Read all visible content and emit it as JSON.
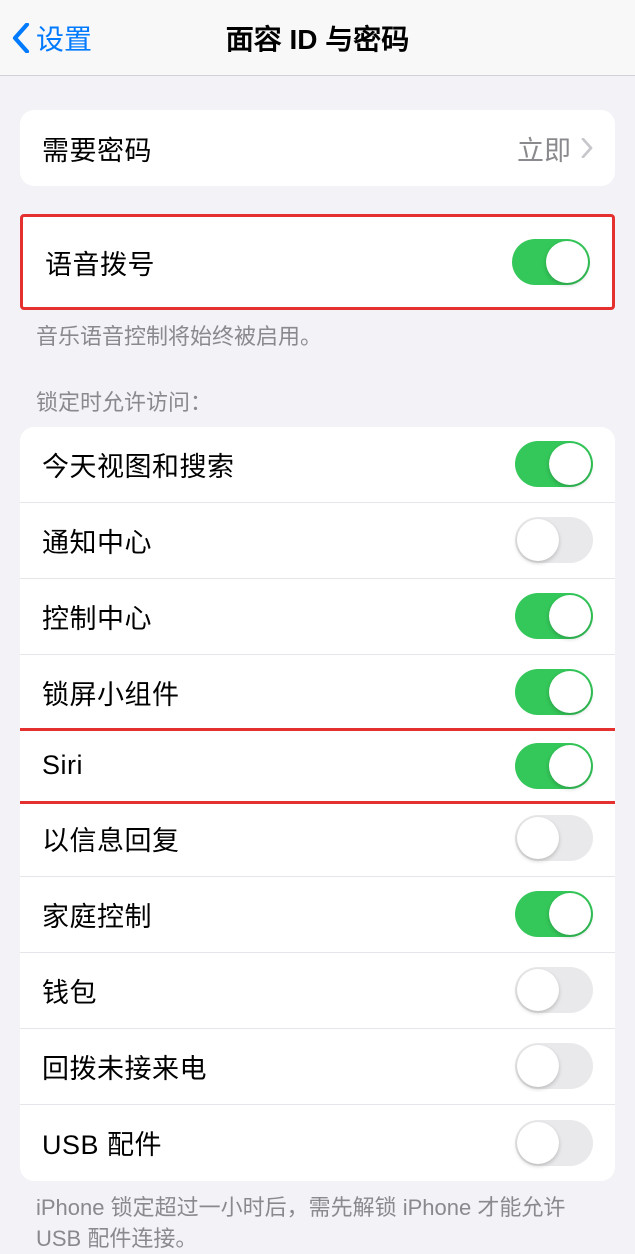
{
  "nav": {
    "back_label": "设置",
    "title": "面容 ID 与密码"
  },
  "passcode_section": {
    "require_passcode_label": "需要密码",
    "require_passcode_value": "立即"
  },
  "voice_dial_section": {
    "label": "语音拨号",
    "enabled": true,
    "footer": "音乐语音控制将始终被启用。"
  },
  "lock_access": {
    "header": "锁定时允许访问：",
    "items": [
      {
        "label": "今天视图和搜索",
        "enabled": true
      },
      {
        "label": "通知中心",
        "enabled": false
      },
      {
        "label": "控制中心",
        "enabled": true
      },
      {
        "label": "锁屏小组件",
        "enabled": true
      },
      {
        "label": "Siri",
        "enabled": true
      },
      {
        "label": "以信息回复",
        "enabled": false
      },
      {
        "label": "家庭控制",
        "enabled": true
      },
      {
        "label": "钱包",
        "enabled": false
      },
      {
        "label": "回拨未接来电",
        "enabled": false
      },
      {
        "label": "USB 配件",
        "enabled": false
      }
    ],
    "footer": "iPhone 锁定超过一小时后，需先解锁 iPhone 才能允许 USB 配件连接。"
  }
}
